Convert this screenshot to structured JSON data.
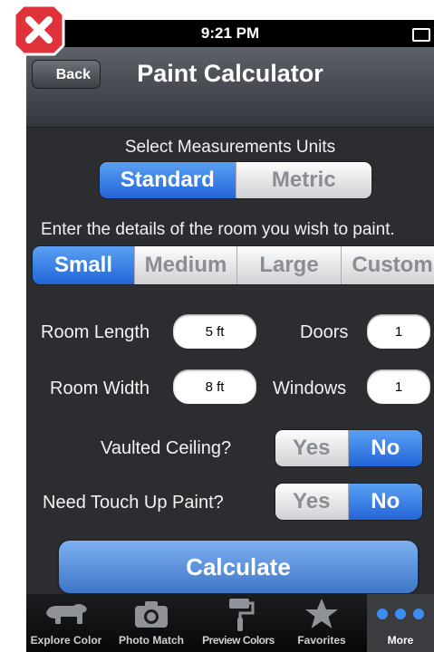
{
  "status": {
    "time": "9:21 PM"
  },
  "nav": {
    "back_label": "Back",
    "title": "Paint Calculator"
  },
  "units": {
    "label": "Select Measurements Units",
    "options": [
      "Standard",
      "Metric"
    ],
    "selected": "Standard"
  },
  "room": {
    "prompt": "Enter the details of the room you wish to paint.",
    "sizes": [
      "Small",
      "Medium",
      "Large",
      "Custom"
    ],
    "selected": "Small"
  },
  "fields": {
    "length_label": "Room Length",
    "length_value": "5 ft",
    "doors_label": "Doors",
    "doors_value": "1",
    "width_label": "Room Width",
    "width_value": "8 ft",
    "windows_label": "Windows",
    "windows_value": "1"
  },
  "vaulted": {
    "label": "Vaulted Ceiling?",
    "yes": "Yes",
    "no": "No",
    "selected": "No"
  },
  "touchup": {
    "label": "Need Touch Up Paint?",
    "yes": "Yes",
    "no": "No",
    "selected": "No"
  },
  "calculate_label": "Calculate",
  "tabs": [
    {
      "label": "Explore Color",
      "icon": "bear-icon"
    },
    {
      "label": "Photo Match",
      "icon": "camera-icon"
    },
    {
      "label": "Preview Colors",
      "icon": "paint-roller-icon"
    },
    {
      "label": "Favorites",
      "icon": "star-icon"
    },
    {
      "label": "More",
      "icon": "more-dots-icon"
    }
  ],
  "active_tab": "More",
  "colors": {
    "selected_blue": "#2f74e0",
    "close_red": "#e0323a"
  }
}
